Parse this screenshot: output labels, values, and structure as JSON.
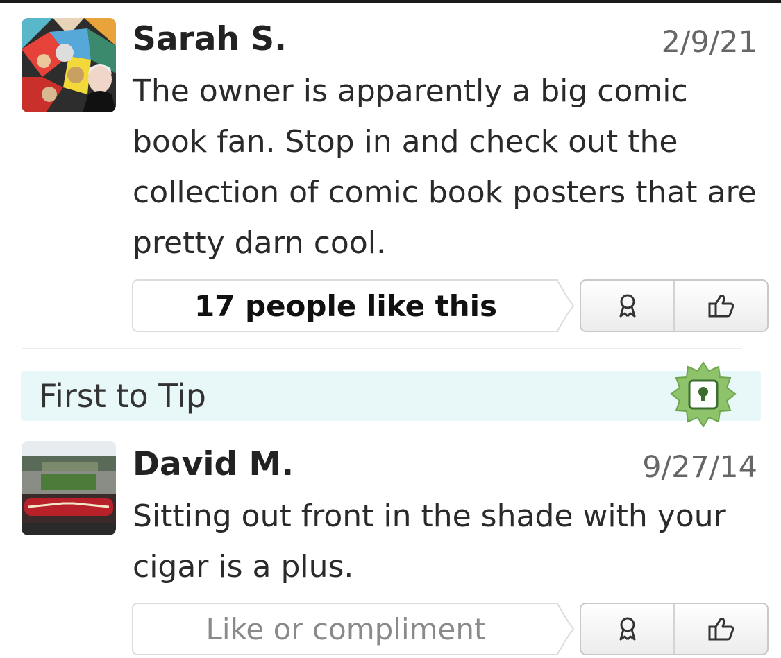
{
  "tips": [
    {
      "author": "Sarah S.",
      "date": "2/9/21",
      "text": "The owner is apparently a big comic book fan. Stop in and check out the collection of comic book posters that are pretty darn cool.",
      "like_text": "17 people like this",
      "compliment_icon": "ribbon-icon",
      "like_icon": "thumbs-up-icon"
    },
    {
      "author": "David M.",
      "date": "9/27/14",
      "text": "Sitting out front in the shade with your cigar is a plus.",
      "like_text": "Like or compliment",
      "compliment_icon": "ribbon-icon",
      "like_icon": "thumbs-up-icon"
    }
  ],
  "banner": {
    "label": "First to Tip",
    "icon": "first-tip-badge-icon"
  },
  "colors": {
    "banner_bg": "#e8f8f9",
    "badge_green": "#8fc36b",
    "text_dark": "#222222",
    "text_muted": "#8a8a8a"
  }
}
